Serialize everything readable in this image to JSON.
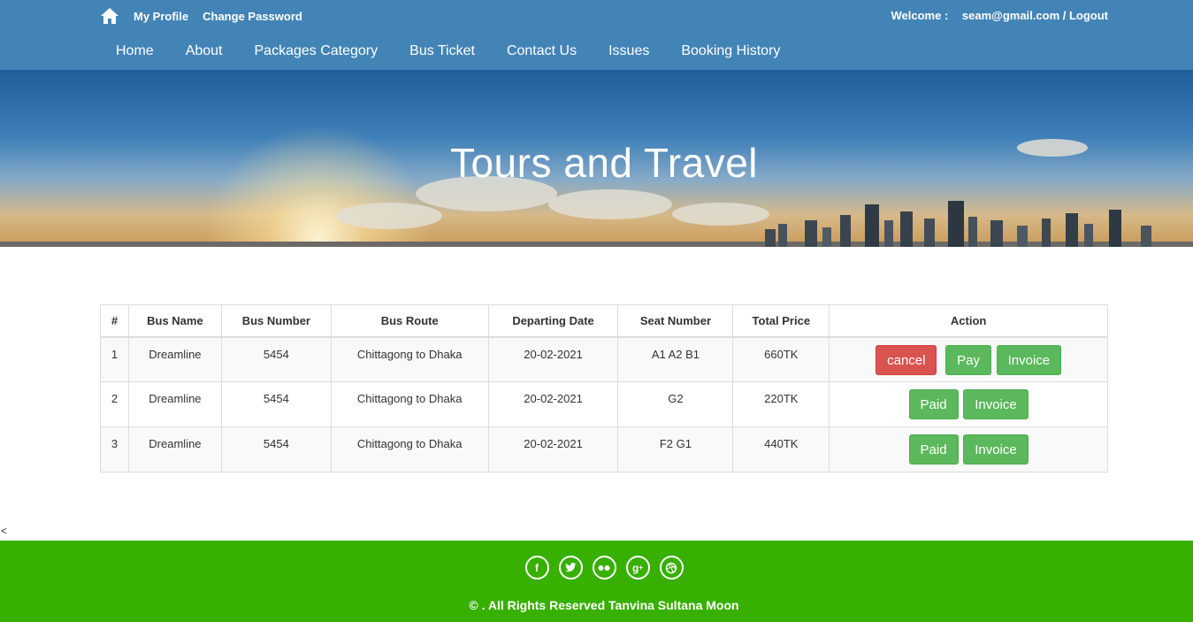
{
  "header": {
    "my_profile": "My Profile",
    "change_password": "Change Password",
    "welcome_label": "Welcome :",
    "user_logout": "seam@gmail.com / Logout"
  },
  "nav": {
    "items": [
      "Home",
      "About",
      "Packages Category",
      "Bus Ticket",
      "Contact Us",
      "Issues",
      "Booking History"
    ]
  },
  "banner": {
    "title": "Tours and Travel"
  },
  "table": {
    "headers": [
      "#",
      "Bus Name",
      "Bus Number",
      "Bus Route",
      "Departing Date",
      "Seat Number",
      "Total Price",
      "Action"
    ],
    "rows": [
      {
        "num": "1",
        "bus_name": "Dreamline",
        "bus_number": "5454",
        "route": "Chittagong to Dhaka",
        "date": "20-02-2021",
        "seats": "A1 A2 B1",
        "price": "660TK",
        "actions": [
          "cancel",
          "Pay",
          "Invoice"
        ]
      },
      {
        "num": "2",
        "bus_name": "Dreamline",
        "bus_number": "5454",
        "route": "Chittagong to Dhaka",
        "date": "20-02-2021",
        "seats": "G2",
        "price": "220TK",
        "actions": [
          "Paid",
          "Invoice"
        ]
      },
      {
        "num": "3",
        "bus_name": "Dreamline",
        "bus_number": "5454",
        "route": "Chittagong to Dhaka",
        "date": "20-02-2021",
        "seats": "F2 G1",
        "price": "440TK",
        "actions": [
          "Paid",
          "Invoice"
        ]
      }
    ]
  },
  "stray_char": "<",
  "footer": {
    "social_icons": [
      "facebook-icon",
      "twitter-icon",
      "flickr-icon",
      "google-plus-icon",
      "dribbble-icon"
    ],
    "copyright": "© . All Rights Reserved Tanvina Sultana Moon"
  },
  "colors": {
    "header_bg": "#4384b6",
    "footer_bg": "#37b000",
    "danger": "#d9534f",
    "success": "#5cb85c"
  }
}
